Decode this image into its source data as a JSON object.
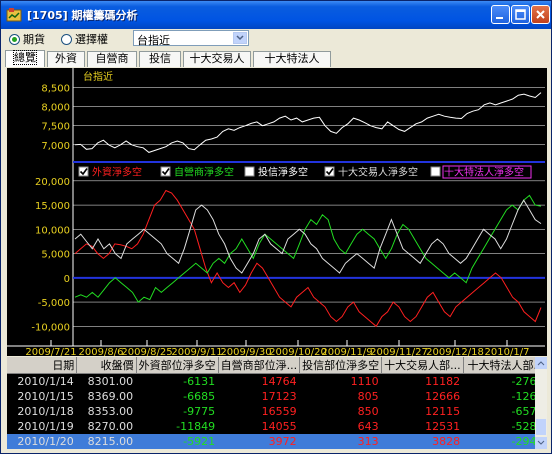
{
  "window": {
    "title": "[1705] 期權籌碼分析"
  },
  "controls": {
    "radio_futures": "期貨",
    "radio_options": "選擇權",
    "select_value": "台指近"
  },
  "tabs": [
    "總覽",
    "外資",
    "自營商",
    "投信",
    "十大交易人",
    "十大特法人"
  ],
  "colors": {
    "foreign": "#ff2020",
    "dealer": "#22dd22",
    "trust": "#ffffff",
    "top10": "#dddddd",
    "top10spec": "#ee30ee",
    "zero_line": "#2233dd"
  },
  "chart_data": [
    {
      "type": "line",
      "title": "台指近",
      "y_ticks": [
        7000,
        7500,
        8000,
        8500
      ],
      "ylim": [
        6600,
        8700
      ],
      "series": [
        {
          "name": "台指近",
          "values": [
            7000,
            7010,
            6880,
            6900,
            7050,
            7120,
            6990,
            6920,
            7000,
            7100,
            7000,
            6950,
            6920,
            6800,
            6850,
            6900,
            6950,
            7050,
            7100,
            7050,
            6900,
            6870,
            7000,
            7120,
            7150,
            7200,
            7350,
            7420,
            7380,
            7450,
            7500,
            7560,
            7600,
            7500,
            7550,
            7600,
            7700,
            7750,
            7650,
            7700,
            7600,
            7650,
            7700,
            7720,
            7500,
            7350,
            7300,
            7450,
            7550,
            7700,
            7650,
            7580,
            7500,
            7450,
            7420,
            7600,
            7500,
            7400,
            7350,
            7450,
            7550,
            7600,
            7700,
            7750,
            7800,
            7750,
            7720,
            7700,
            7690,
            7820,
            7880,
            7920,
            8050,
            8100,
            8050,
            8100,
            8150,
            8200,
            8300,
            8330,
            8280,
            8240,
            8370
          ]
        }
      ]
    },
    {
      "type": "line",
      "y_ticks": [
        -10000,
        -5000,
        0,
        5000,
        10000,
        15000,
        20000
      ],
      "ylim": [
        -12000,
        21000
      ],
      "x_ticks": [
        "2009/7/21",
        "2009/8/6",
        "2009/8/25",
        "2009/9/11",
        "2009/9/30",
        "2009/10/20",
        "2009/11/9",
        "2009/11/27",
        "2009/12/18",
        "2010/1/7"
      ],
      "legend": [
        {
          "label": "外資淨多空",
          "checked": true
        },
        {
          "label": "自營商淨多空",
          "checked": true
        },
        {
          "label": "投信淨多空",
          "checked": false
        },
        {
          "label": "十大交易人淨多空",
          "checked": true
        },
        {
          "label": "十大特法人淨多空",
          "checked": false
        }
      ],
      "series": [
        {
          "name": "外資淨多空",
          "values": [
            5000,
            6000,
            7000,
            6500,
            5000,
            4000,
            5000,
            7000,
            6800,
            6500,
            6000,
            7000,
            9000,
            12000,
            15000,
            16000,
            18000,
            17500,
            16000,
            14000,
            12000,
            10000,
            6000,
            2000,
            -1000,
            1000,
            -1000,
            -2000,
            -1000,
            -3000,
            -1500,
            1000,
            3000,
            2000,
            0,
            -2000,
            -4000,
            -5000,
            -6000,
            -4000,
            -3000,
            -2000,
            -4000,
            -5000,
            -6000,
            -8000,
            -9000,
            -8000,
            -6000,
            -5000,
            -7000,
            -8000,
            -9000,
            -10000,
            -8000,
            -7000,
            -5000,
            -6000,
            -8000,
            -9000,
            -8000,
            -6000,
            -4000,
            -3000,
            -5000,
            -7000,
            -8000,
            -6000,
            -5000,
            -4000,
            -3000,
            -2000,
            -1000,
            0,
            1000,
            0,
            -2000,
            -4000,
            -5000,
            -7000,
            -8000,
            -9000,
            -6131
          ]
        },
        {
          "name": "自營商淨多空",
          "values": [
            -4000,
            -3500,
            -4000,
            -3000,
            -4000,
            -2500,
            -1000,
            0,
            -1000,
            -2000,
            -3000,
            -5000,
            -4000,
            -4500,
            -2000,
            -3000,
            -2000,
            -1000,
            0,
            1000,
            2000,
            3000,
            2000,
            1000,
            3000,
            4000,
            3000,
            5000,
            6000,
            8000,
            6000,
            4000,
            7000,
            9000,
            8000,
            7000,
            6000,
            5000,
            4000,
            7000,
            10000,
            12000,
            11000,
            13000,
            12000,
            8000,
            6000,
            5000,
            7000,
            9000,
            10000,
            9000,
            8000,
            6000,
            4000,
            6000,
            9000,
            11000,
            10000,
            8000,
            6000,
            4000,
            3000,
            2000,
            1000,
            0,
            1000,
            0,
            -1000,
            2000,
            4000,
            6000,
            8000,
            10000,
            12000,
            14000,
            15000,
            14000,
            16000,
            17000,
            15000,
            14764
          ]
        },
        {
          "name": "十大交易人淨多空",
          "values": [
            8000,
            9000,
            7500,
            6000,
            8000,
            6000,
            7000,
            5000,
            4000,
            7000,
            8000,
            9000,
            10000,
            9000,
            8000,
            7000,
            5000,
            4000,
            3000,
            6000,
            10000,
            14000,
            15000,
            14000,
            12000,
            9000,
            7000,
            4000,
            2000,
            1000,
            3000,
            5000,
            8000,
            9000,
            7000,
            6000,
            5000,
            8000,
            9000,
            10000,
            9000,
            7000,
            6000,
            4000,
            3000,
            2000,
            1000,
            3000,
            4000,
            5000,
            4000,
            3000,
            2000,
            6000,
            9000,
            12000,
            9000,
            6000,
            5000,
            4000,
            3000,
            5000,
            7000,
            8000,
            7000,
            5000,
            4000,
            3000,
            4000,
            6000,
            8000,
            10000,
            9000,
            8000,
            6000,
            8000,
            11000,
            14000,
            16000,
            14000,
            12000,
            11182
          ]
        }
      ]
    }
  ],
  "table": {
    "headers": [
      "日期",
      "收盤價",
      "外資部位淨多空",
      "自營商部位淨...",
      "投信部位淨多空",
      "十大交易人部...",
      "十大特法人部..."
    ],
    "rows": [
      [
        "2010/1/14",
        "8301.00",
        "-6131",
        "14764",
        "1110",
        "11182",
        "-2765"
      ],
      [
        "2010/1/15",
        "8369.00",
        "-6685",
        "17123",
        "805",
        "12666",
        "-1262"
      ],
      [
        "2010/1/18",
        "8353.00",
        "-9775",
        "16559",
        "850",
        "12115",
        "-6571"
      ],
      [
        "2010/1/19",
        "8270.00",
        "-11849",
        "14055",
        "643",
        "12531",
        "-5285"
      ],
      [
        "2010/1/20",
        "8215.00",
        "-5921",
        "3972",
        "313",
        "3828",
        "-2946"
      ]
    ]
  }
}
